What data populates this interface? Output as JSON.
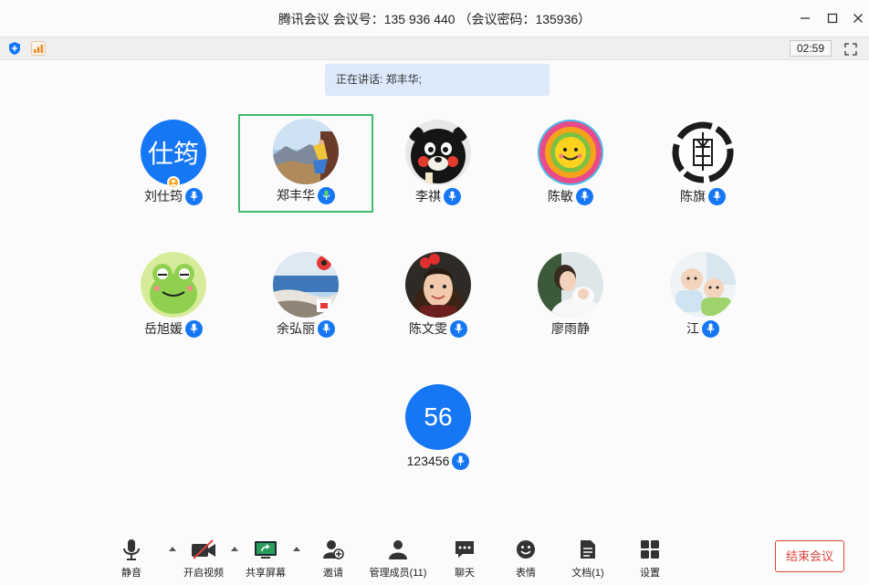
{
  "window": {
    "title": "腾讯会议 会议号：135 936 440 （会议密码：135936）"
  },
  "infobar": {
    "timer": "02:59"
  },
  "speaking": {
    "text": "正在讲话: 郑丰华;"
  },
  "participants": [
    {
      "name": "刘仕筠",
      "avatar_text": "仕筠",
      "host": true
    },
    {
      "name": "郑丰华",
      "active": true
    },
    {
      "name": "李祺"
    },
    {
      "name": "陈敏"
    },
    {
      "name": "陈旗"
    },
    {
      "name": "岳旭媛"
    },
    {
      "name": "余弘丽"
    },
    {
      "name": "陈文雯"
    },
    {
      "name": "廖雨静"
    },
    {
      "name": "江"
    },
    {
      "name": "123456",
      "avatar_text": "56"
    }
  ],
  "toolbar": {
    "mute": "静音",
    "video": "开启视频",
    "share": "共享屏幕",
    "invite": "邀请",
    "members": "管理成员(11)",
    "chat": "聊天",
    "emoji": "表情",
    "docs": "文档(1)",
    "settings": "设置",
    "end": "结束会议"
  },
  "colors": {
    "accent": "#1677f5",
    "active_border": "#3cbd6b",
    "end": "#e0413a"
  }
}
